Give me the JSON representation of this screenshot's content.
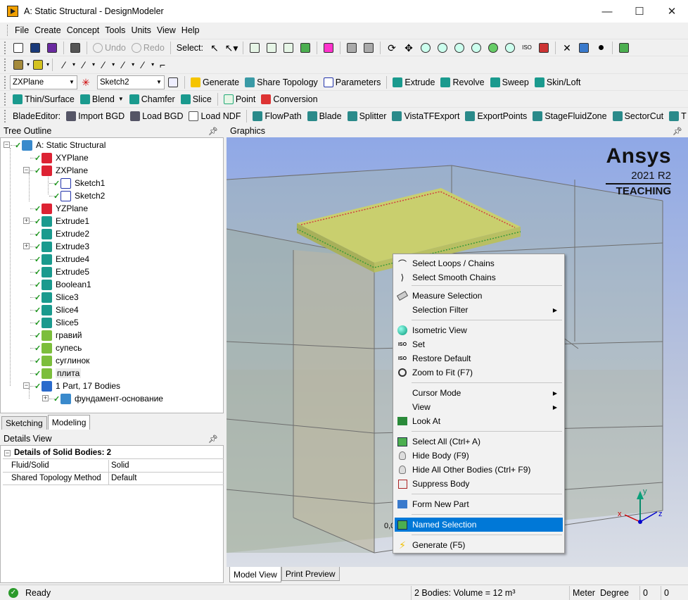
{
  "window": {
    "title": "A: Static Structural - DesignModeler",
    "minimize": "—",
    "maximize": "☐",
    "close": "✕"
  },
  "menu": [
    "File",
    "Create",
    "Concept",
    "Tools",
    "Units",
    "View",
    "Help"
  ],
  "toolbar1": {
    "undo": "Undo",
    "redo": "Redo",
    "select_label": "Select:"
  },
  "toolbar3": {
    "plane_value": "ZXPlane",
    "sketch_value": "Sketch2",
    "generate": "Generate",
    "share_topology": "Share Topology",
    "parameters": "Parameters",
    "extrude": "Extrude",
    "revolve": "Revolve",
    "sweep": "Sweep",
    "skin_loft": "Skin/Loft"
  },
  "toolbar4": {
    "thin_surface": "Thin/Surface",
    "blend": "Blend",
    "chamfer": "Chamfer",
    "slice": "Slice",
    "point": "Point",
    "conversion": "Conversion"
  },
  "toolbar5": {
    "label": "BladeEditor:",
    "import_bgd": "Import BGD",
    "load_bgd": "Load BGD",
    "load_ndf": "Load NDF",
    "flowpath": "FlowPath",
    "blade": "Blade",
    "splitter": "Splitter",
    "vistatf": "VistaTFExport",
    "exportpoints": "ExportPoints",
    "stagefluidzone": "StageFluidZone",
    "sectorcut": "SectorCut",
    "cut_off": "T"
  },
  "tree_outline": {
    "title": "Tree Outline",
    "items": [
      "A: Static Structural",
      "XYPlane",
      "ZXPlane",
      "Sketch1",
      "Sketch2",
      "YZPlane",
      "Extrude1",
      "Extrude2",
      "Extrude3",
      "Extrude4",
      "Extrude5",
      "Boolean1",
      "Slice3",
      "Slice4",
      "Slice5",
      "гравий",
      "супесь",
      "суглинок",
      "плита",
      "1 Part, 17 Bodies",
      "фундамент-основание"
    ]
  },
  "tabs": {
    "sketching": "Sketching",
    "modeling": "Modeling"
  },
  "details": {
    "title": "Details View",
    "header": "Details of Solid Bodies: 2",
    "rows": [
      {
        "key": "Fluid/Solid",
        "value": "Solid"
      },
      {
        "key": "Shared Topology Method",
        "value": "Default"
      }
    ]
  },
  "graphics": {
    "title": "Graphics",
    "brand": "Ansys",
    "version": "2021 R2",
    "edition": "TEACHING",
    "coord_text": "0,0"
  },
  "context_menu": [
    {
      "label": "Select Loops / Chains",
      "icon": "select-loops-icon"
    },
    {
      "label": "Select Smooth Chains",
      "icon": "smooth-chains-icon"
    },
    {
      "label": "Measure Selection",
      "icon": "ruler-icon"
    },
    {
      "label": "Selection Filter",
      "icon": "",
      "submenu": true
    },
    {
      "label": "Isometric View",
      "icon": "sphere-icon"
    },
    {
      "label": "Set",
      "icon": "iso-icon"
    },
    {
      "label": "Restore Default",
      "icon": "iso-icon"
    },
    {
      "label": "Zoom to Fit (F7)",
      "icon": "zoom-fit-icon"
    },
    {
      "label": "Cursor Mode",
      "icon": "",
      "submenu": true
    },
    {
      "label": "View",
      "icon": "",
      "submenu": true
    },
    {
      "label": "Look At",
      "icon": "look-at-icon"
    },
    {
      "label": "Select All (Ctrl+ A)",
      "icon": "select-all-icon"
    },
    {
      "label": "Hide Body (F9)",
      "icon": "bulb-icon"
    },
    {
      "label": "Hide All Other Bodies (Ctrl+ F9)",
      "icon": "bulb-icon"
    },
    {
      "label": "Suppress Body",
      "icon": "suppress-icon"
    },
    {
      "label": "Form New Part",
      "icon": "form-part-icon"
    },
    {
      "label": "Named Selection",
      "icon": "named-selection-icon",
      "highlighted": true
    },
    {
      "label": "Generate (F5)",
      "icon": "lightning-icon"
    }
  ],
  "bottom_tabs": {
    "model_view": "Model View",
    "print_preview": "Print Preview"
  },
  "status": {
    "ready": "Ready",
    "bodies": "2 Bodies: Volume = 12 m³",
    "units": "Meter",
    "angle": "Degree",
    "v1": "0",
    "v2": "0"
  },
  "colors": {
    "highlight": "#0078d7",
    "plate": "#c9cf6e",
    "graphics_top": "#8fa9e6",
    "graphics_bottom": "#d8dde6"
  }
}
